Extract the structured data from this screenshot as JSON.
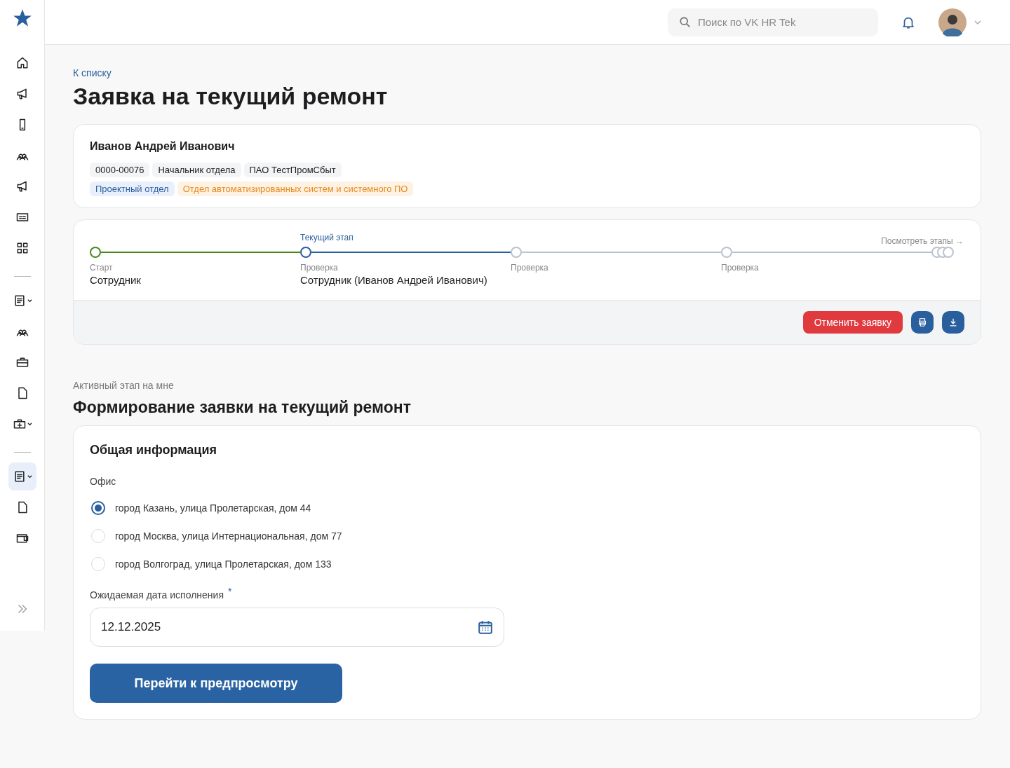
{
  "sidebar": {
    "groups": [
      {
        "items": [
          {
            "kind": "home",
            "submenu": false,
            "selected": false
          },
          {
            "kind": "megaphone",
            "submenu": false,
            "selected": false
          },
          {
            "kind": "phone",
            "submenu": false,
            "selected": false
          },
          {
            "kind": "people",
            "submenu": false,
            "selected": false
          },
          {
            "kind": "megaphone",
            "submenu": false,
            "selected": false
          },
          {
            "kind": "card",
            "submenu": false,
            "selected": false
          },
          {
            "kind": "grid",
            "submenu": false,
            "selected": false
          }
        ]
      },
      {
        "items": [
          {
            "kind": "document",
            "submenu": true,
            "selected": false
          },
          {
            "kind": "people",
            "submenu": false,
            "selected": false
          },
          {
            "kind": "briefcase",
            "submenu": false,
            "selected": false
          },
          {
            "kind": "file",
            "submenu": false,
            "selected": false
          },
          {
            "kind": "medkit",
            "submenu": true,
            "selected": false
          }
        ]
      },
      {
        "items": [
          {
            "kind": "document",
            "submenu": true,
            "selected": true
          },
          {
            "kind": "file",
            "submenu": false,
            "selected": false
          },
          {
            "kind": "wallet",
            "submenu": false,
            "selected": false
          }
        ]
      }
    ]
  },
  "header": {
    "search": {
      "placeholder": "Поиск по VK HR Tek"
    }
  },
  "back_link": "К списку",
  "title": "Заявка на текущий ремонт",
  "employee": {
    "name": "Иванов Андрей Иванович",
    "tags": [
      {
        "text": "0000-00076",
        "kind": "plain"
      },
      {
        "text": "Начальник отдела",
        "kind": "plain"
      },
      {
        "text": "ПАО ТестПромСбыт",
        "kind": "plain"
      }
    ],
    "tags2": [
      {
        "text": "Проектный отдел",
        "kind": "blue"
      },
      {
        "text": "Отдел автоматизированных систем и системного ПО",
        "kind": "orange"
      }
    ]
  },
  "stages": {
    "current_label": "Текущий этап",
    "view_link": "Посмотреть этапы →",
    "items": [
      {
        "done": true,
        "current": false,
        "label": "Старт",
        "person": "Сотрудник"
      },
      {
        "done": false,
        "current": true,
        "label": "Проверка",
        "person": "Сотрудник (Иванов Андрей Иванович)"
      },
      {
        "done": false,
        "current": false,
        "label": "Проверка"
      },
      {
        "done": false,
        "current": false,
        "label": "Проверка"
      }
    ],
    "cancel_button": "Отменить заявку"
  },
  "active_stage": {
    "caption": "Активный этап на мне",
    "title": "Формирование заявки на текущий ремонт"
  },
  "form": {
    "section": "Общая информация",
    "office_label": "Офис",
    "offices": [
      {
        "text": "город Казань, улица Пролетарская, дом 44",
        "selected": true
      },
      {
        "text": "город Москва, улица Интернациональная, дом 77",
        "selected": false
      },
      {
        "text": "город Волгоград, улица Пролетарская, дом 133",
        "selected": false
      }
    ],
    "date_label": "Ожидаемая дата исполнения",
    "required_mark": "*",
    "date_value": "12.12.2025",
    "submit": "Перейти к предпросмотру"
  }
}
